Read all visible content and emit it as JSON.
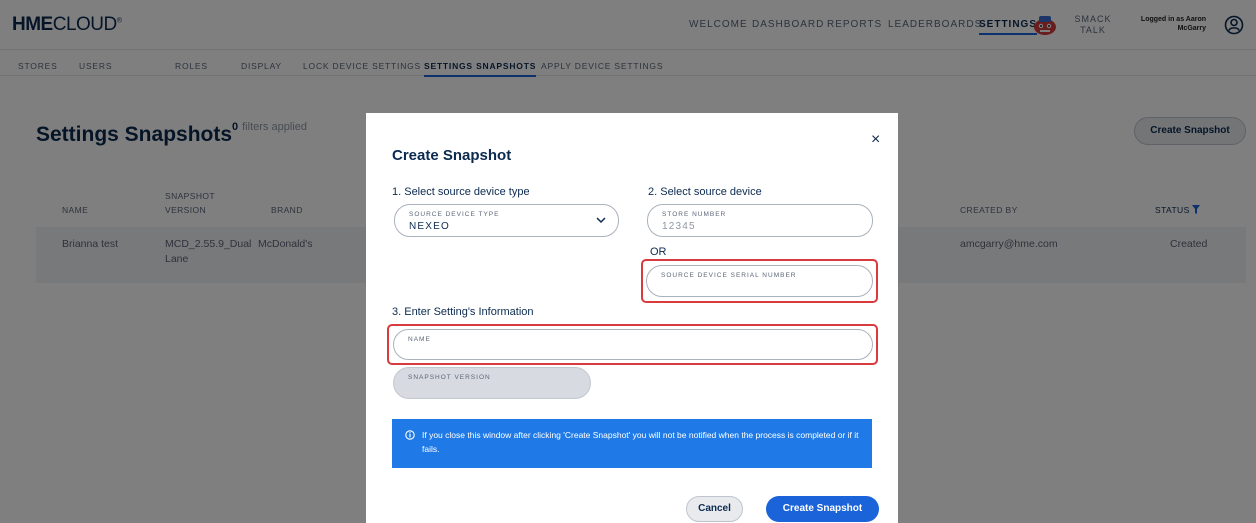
{
  "header": {
    "logo_bold": "HME",
    "logo_light": "CLOUD",
    "nav": [
      "WELCOME",
      "DASHBOARD",
      "REPORTS",
      "LEADERBOARDS",
      "SETTINGS"
    ],
    "smack_talk_line1": "SMACK",
    "smack_talk_line2": "TALK",
    "logged_in_line1": "Logged in as Aaron",
    "logged_in_line2": "McGarry"
  },
  "subnav": [
    "STORES",
    "USERS",
    "ROLES",
    "DISPLAY",
    "LOCK DEVICE SETTINGS",
    "SETTINGS SNAPSHOTS",
    "APPLY DEVICE SETTINGS"
  ],
  "page": {
    "title": "Settings Snapshots",
    "filters_count": "0",
    "filters_text": "filters applied",
    "create_button": "Create Snapshot"
  },
  "table": {
    "headers": {
      "name": "NAME",
      "snapshot_version_1": "SNAPSHOT",
      "snapshot_version_2": "VERSION",
      "brand": "BRAND",
      "created_by": "CREATED BY",
      "status": "STATUS"
    },
    "rows": [
      {
        "name": "Brianna test",
        "version_1": "MCD_2.55.9_Dual",
        "version_2": "Lane",
        "brand": "McDonald's",
        "created_by": "amcgarry@hme.com",
        "status": "Created"
      }
    ]
  },
  "modal": {
    "title": "Create Snapshot",
    "close": "×",
    "step1": "1. Select source device type",
    "step2": "2. Select source device",
    "step3": "3. Enter Setting's Information",
    "device_type_label": "SOURCE DEVICE TYPE",
    "device_type_value": "NEXEO",
    "store_number_label": "STORE NUMBER",
    "store_number_placeholder": "12345",
    "or": "OR",
    "serial_label": "SOURCE DEVICE SERIAL NUMBER",
    "name_label": "NAME",
    "snapshot_version_label": "SNAPSHOT VERSION",
    "info_text": "If you close this window after clicking 'Create Snapshot' you will not be notified when the process is completed or if it fails.",
    "cancel": "Cancel",
    "create": "Create Snapshot"
  },
  "colors": {
    "navy": "#0b2a4f",
    "accent_blue": "#1b63d9",
    "info_blue": "#1f7ae8",
    "highlight_red": "#d93a3e"
  },
  "icons": [
    "smack-talk-mascot-icon",
    "user-circle-icon",
    "filter-icon",
    "close-icon",
    "chevron-down-icon",
    "info-icon"
  ]
}
